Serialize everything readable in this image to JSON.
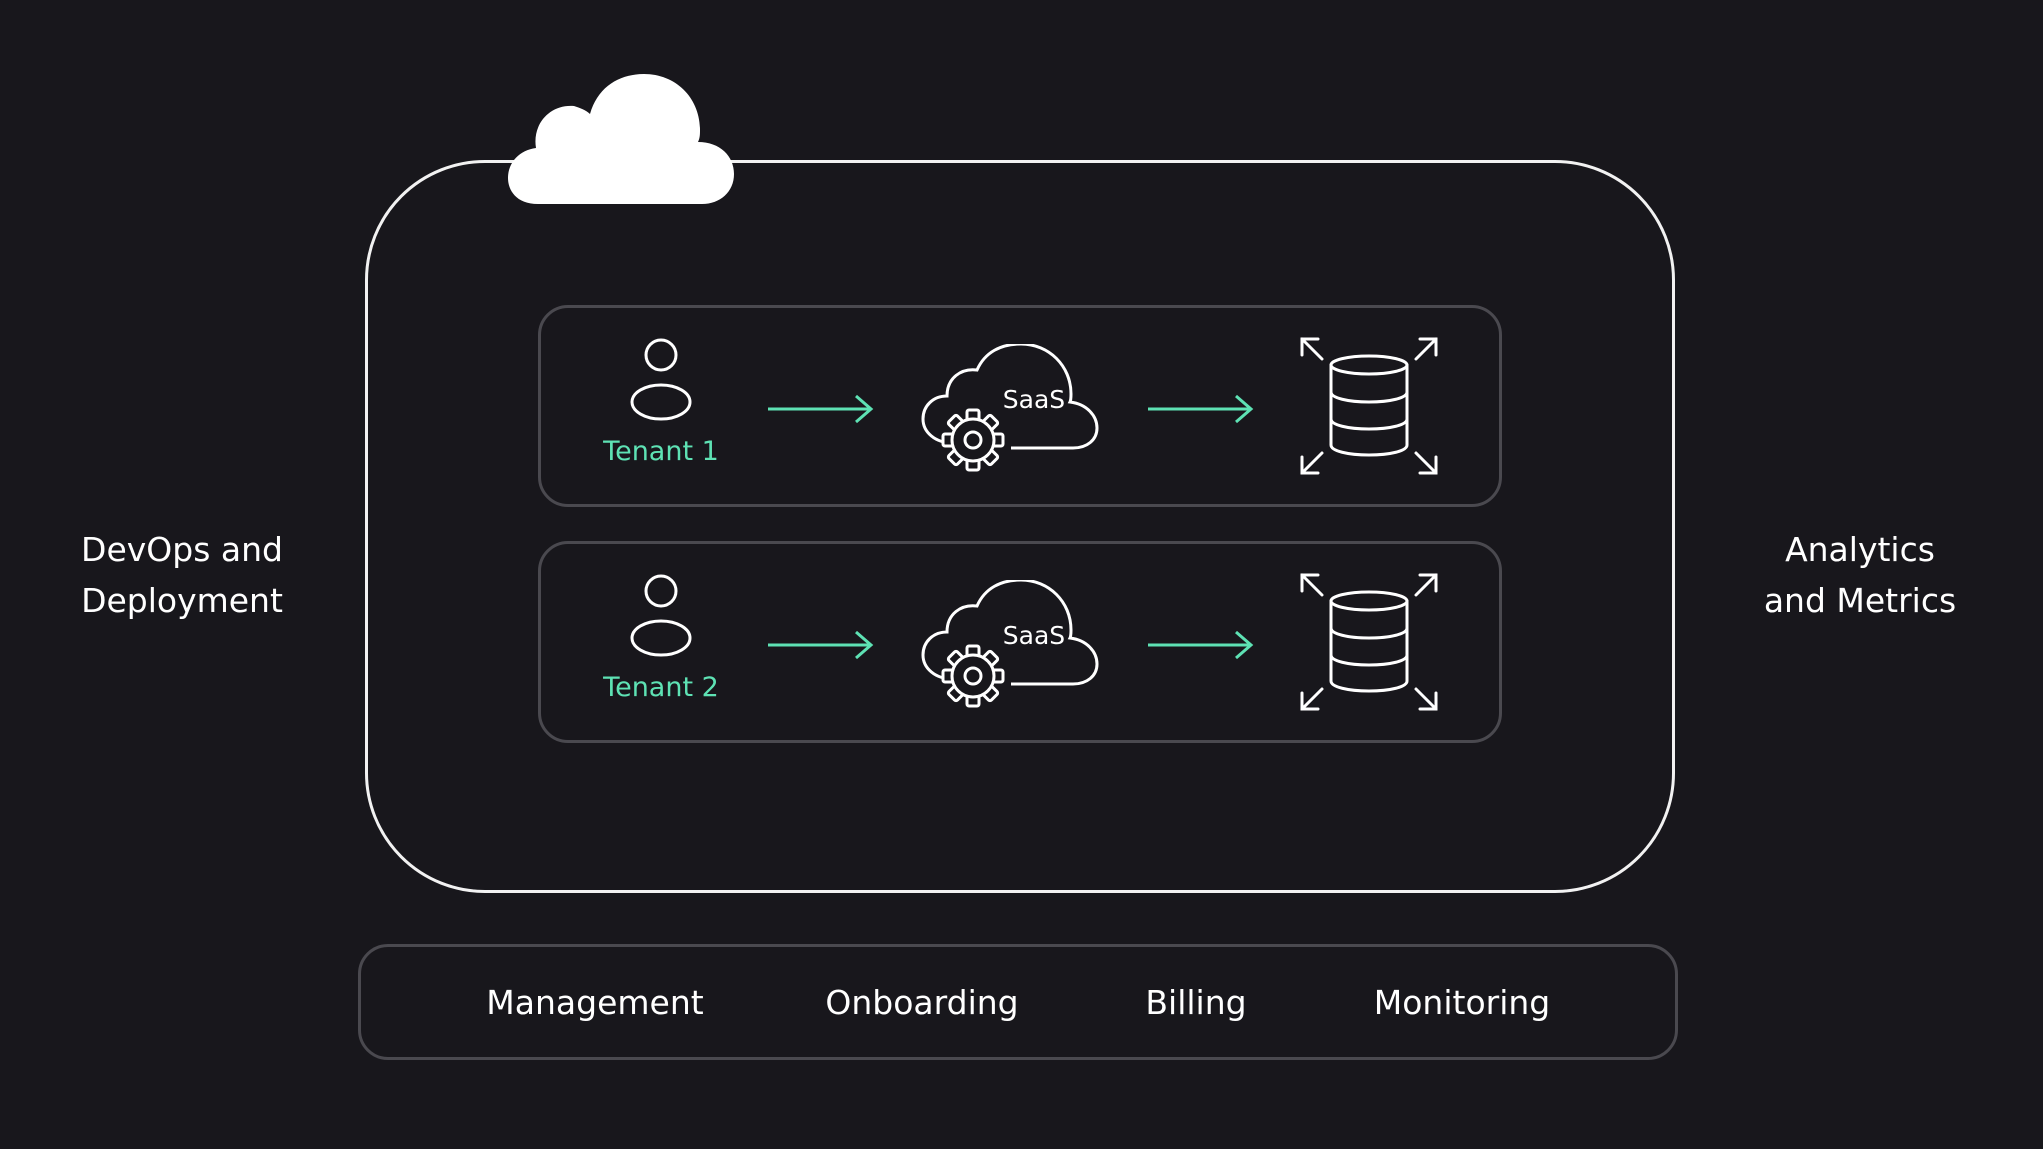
{
  "left_label": "DevOps and\nDeployment",
  "right_label": "Analytics\nand Metrics",
  "tenants": [
    {
      "label": "Tenant 1",
      "service_label": "SaaS"
    },
    {
      "label": "Tenant 2",
      "service_label": "SaaS"
    }
  ],
  "services": [
    "Management",
    "Onboarding",
    "Billing",
    "Monitoring"
  ],
  "icons": {
    "top": "cloud-icon",
    "tenant": "user-icon",
    "flow": "arrow-right-icon",
    "service": "saas-cloud-gear-icon",
    "storage": "scalable-database-icon"
  },
  "colors": {
    "background": "#18171c",
    "outline": "#f2f2f2",
    "inner_border": "#4a494f",
    "accent": "#5ee2b4",
    "text": "#ffffff"
  }
}
